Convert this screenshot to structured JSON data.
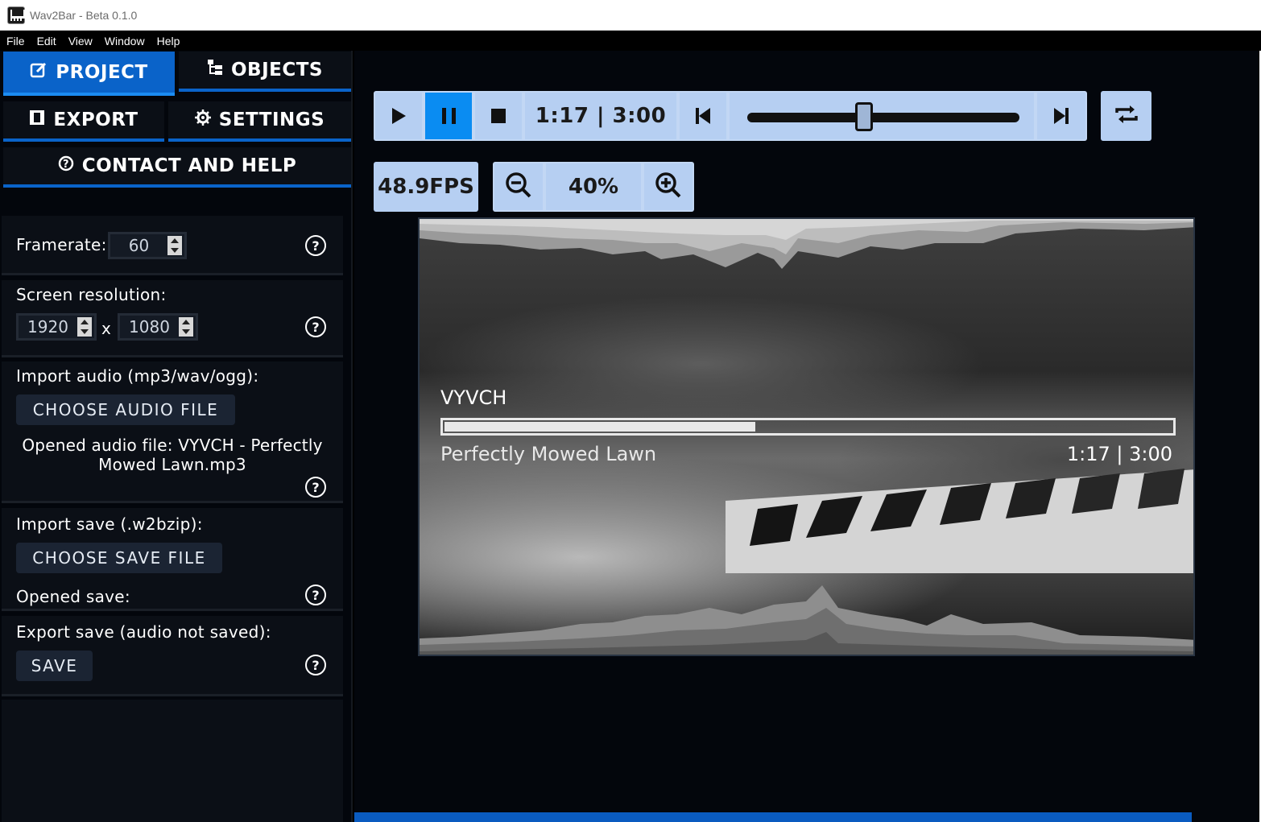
{
  "window": {
    "title": "Wav2Bar - Beta 0.1.0"
  },
  "menu": [
    "File",
    "Edit",
    "View",
    "Window",
    "Help"
  ],
  "tabs": {
    "project": "PROJECT",
    "objects": "OBJECTS",
    "export": "EXPORT",
    "settings": "SETTINGS",
    "contact": "CONTACT AND HELP"
  },
  "project": {
    "framerate_label": "Framerate:",
    "framerate_value": "60",
    "resolution_label": "Screen resolution:",
    "res_width": "1920",
    "res_x": "x",
    "res_height": "1080",
    "audio_label": "Import audio (mp3/wav/ogg):",
    "audio_button": "CHOOSE AUDIO FILE",
    "audio_opened": "Opened audio file: VYVCH - Perfectly Mowed Lawn.mp3",
    "save_label": "Import save (.w2bzip):",
    "save_button": "CHOOSE SAVE FILE",
    "save_opened": "Opened save:",
    "export_label": "Export save (audio not saved):",
    "export_button": "SAVE",
    "help_glyph": "?"
  },
  "player": {
    "time": "1:17 | 3:00",
    "progress": 0.428,
    "playing": true,
    "fps": "48.9FPS",
    "zoom": "40%"
  },
  "preview": {
    "artist": "VYVCH",
    "track": "Perfectly Mowed Lawn",
    "time": "1:17 | 3:00",
    "progress": 0.428
  },
  "colors": {
    "accent": "#0a63c9",
    "control_bg": "#b6cff2",
    "active_control": "#0a8cf2"
  }
}
